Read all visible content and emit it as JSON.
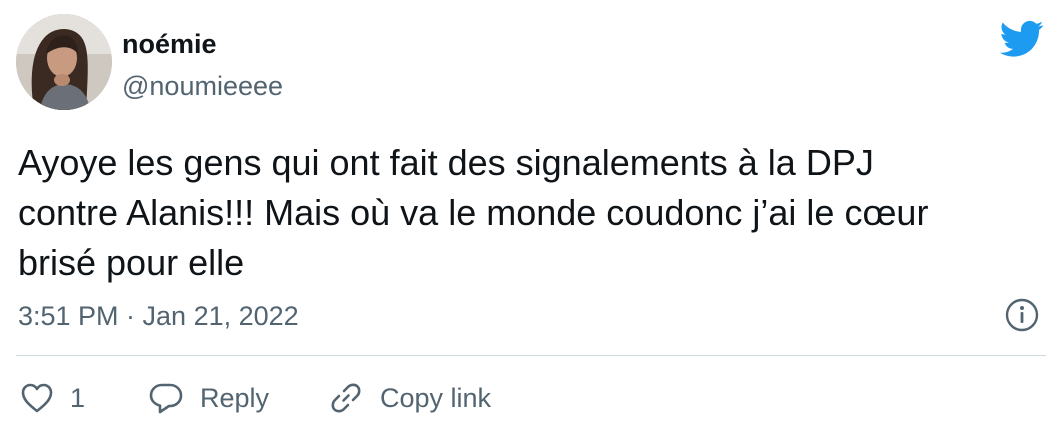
{
  "user": {
    "display_name": "noémie",
    "handle": "@noumieeee",
    "avatar": "profile-photo"
  },
  "tweet": {
    "text": "Ayoye les gens qui ont fait des signalements à la DPJ\ncontre Alanis!!! Mais où va le monde coudonc j’ai le cœur\nbrisé pour elle",
    "timestamp": "3:51 PM · Jan 21, 2022"
  },
  "actions": {
    "like_count": "1",
    "reply_label": "Reply",
    "copy_link_label": "Copy link"
  },
  "icons": {
    "brand": "twitter-bird-icon",
    "info": "info-icon",
    "like": "heart-icon",
    "reply": "reply-bubble-icon",
    "copy": "link-icon"
  },
  "colors": {
    "twitter_blue": "#1d9bf0",
    "text_primary": "#0f1419",
    "text_secondary": "#536471",
    "divider": "#cfd9de"
  }
}
